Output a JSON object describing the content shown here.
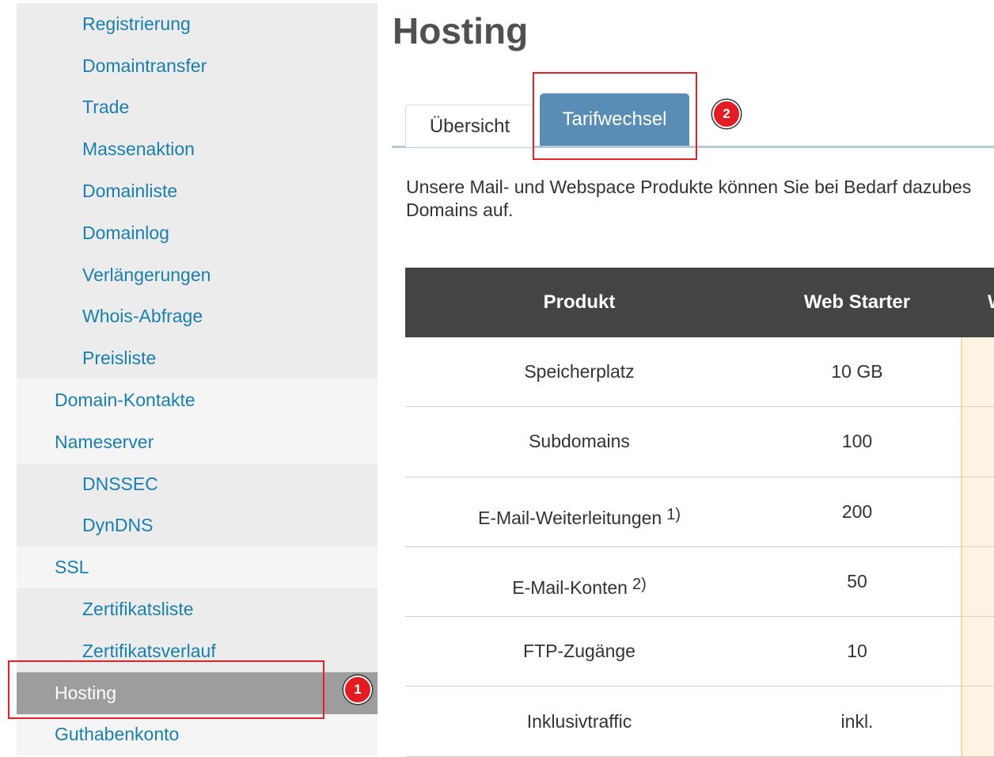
{
  "sidebar": {
    "items": [
      {
        "label": "Registrierung"
      },
      {
        "label": "Domaintransfer"
      },
      {
        "label": "Trade"
      },
      {
        "label": "Massenaktion"
      },
      {
        "label": "Domainliste"
      },
      {
        "label": "Domainlog"
      },
      {
        "label": "Verlängerungen"
      },
      {
        "label": "Whois-Abfrage"
      },
      {
        "label": "Preisliste"
      },
      {
        "label": "Domain-Kontakte"
      },
      {
        "label": "Nameserver"
      },
      {
        "label": "DNSSEC"
      },
      {
        "label": "DynDNS"
      },
      {
        "label": "SSL"
      },
      {
        "label": "Zertifikatsliste"
      },
      {
        "label": "Zertifikatsverlauf"
      },
      {
        "label": "Hosting"
      },
      {
        "label": "Guthabenkonto"
      }
    ]
  },
  "annotations": {
    "badge1": "1",
    "badge2": "2"
  },
  "page": {
    "title": "Hosting",
    "tabs": [
      {
        "label": "Übersicht"
      },
      {
        "label": "Tarifwechsel"
      }
    ],
    "intro_line1": "Unsere Mail- und Webspace Produkte können Sie bei Bedarf dazubes",
    "intro_line2": "Domains auf."
  },
  "table": {
    "headers": [
      "Produkt",
      "Web Starter",
      "W"
    ],
    "rows": [
      {
        "feature": "Speicherplatz",
        "footnote": "",
        "value": "10 GB"
      },
      {
        "feature": "Subdomains",
        "footnote": "",
        "value": "100"
      },
      {
        "feature": "E-Mail-Weiterleitungen",
        "footnote": "1)",
        "value": "200"
      },
      {
        "feature": "E-Mail-Konten",
        "footnote": "2)",
        "value": "50"
      },
      {
        "feature": "FTP-Zugänge",
        "footnote": "",
        "value": "10"
      },
      {
        "feature": "Inklusivtraffic",
        "footnote": "",
        "value": "inkl."
      }
    ]
  },
  "colors": {
    "link": "#1a7fb0",
    "active_tab": "#5a8db5",
    "annotation": "#e4202a",
    "table_header": "#444444"
  }
}
